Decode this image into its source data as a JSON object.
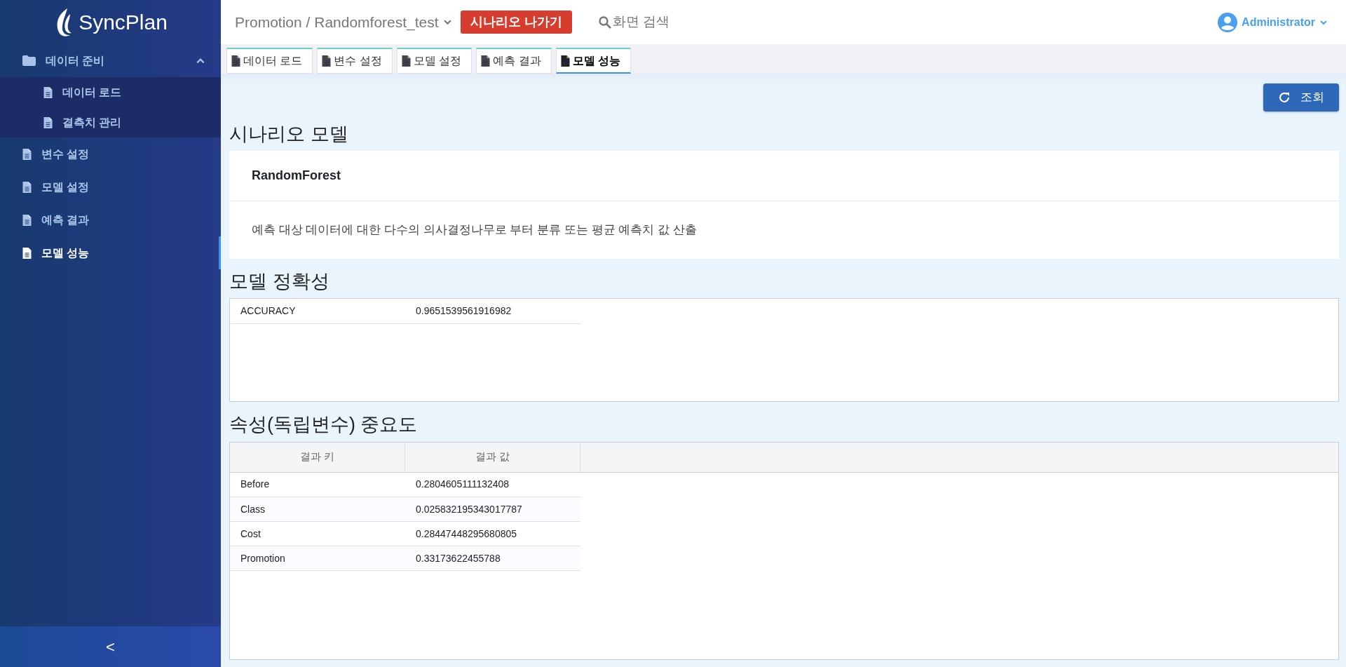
{
  "app": {
    "logo": "SyncPlan"
  },
  "sidebar": {
    "items": [
      {
        "label": "데이터 준비",
        "kind": "folder",
        "expanded": true,
        "selected": false,
        "children": [
          {
            "label": "데이터 로드",
            "kind": "file",
            "selected": false
          },
          {
            "label": "결측치 관리",
            "kind": "file",
            "selected": false
          }
        ]
      },
      {
        "label": "변수 설정",
        "kind": "file",
        "selected": false
      },
      {
        "label": "모델 설정",
        "kind": "file",
        "selected": false
      },
      {
        "label": "예측 결과",
        "kind": "file",
        "selected": false
      },
      {
        "label": "모델 성능",
        "kind": "file",
        "selected": true
      }
    ],
    "collapse": "<"
  },
  "header": {
    "breadcrumb": "Promotion / Randomforest_test",
    "exit_button": "시나리오 나가기",
    "search": "화면 검색",
    "user": "Administrator"
  },
  "tabs": [
    {
      "label": "데이터 로드",
      "selected": false
    },
    {
      "label": "변수 설정",
      "selected": false
    },
    {
      "label": "모델 설정",
      "selected": false
    },
    {
      "label": "예측 결과",
      "selected": false
    },
    {
      "label": "모델 성능",
      "selected": true
    }
  ],
  "refresh_button": "조회",
  "model": {
    "heading": "시나리오 모델",
    "name": "RandomForest",
    "description": "예측 대상 데이터에 대한 다수의 의사결정나무로 부터 분류 또는 평균 예측치 값 산출"
  },
  "accuracy": {
    "heading": "모델 정확성",
    "rows": [
      {
        "key": "ACCURACY",
        "value": "0.9651539561916982"
      }
    ]
  },
  "importance": {
    "heading": "속성(독립변수) 중요도",
    "columns": [
      "결과 키",
      "결과 값"
    ],
    "rows": [
      {
        "key": "Before",
        "value": "0.2804605111132408"
      },
      {
        "key": "Class",
        "value": "0.025832195343017787"
      },
      {
        "key": "Cost",
        "value": "0.28447448295680805"
      },
      {
        "key": "Promotion",
        "value": "0.33173622455788"
      }
    ]
  }
}
